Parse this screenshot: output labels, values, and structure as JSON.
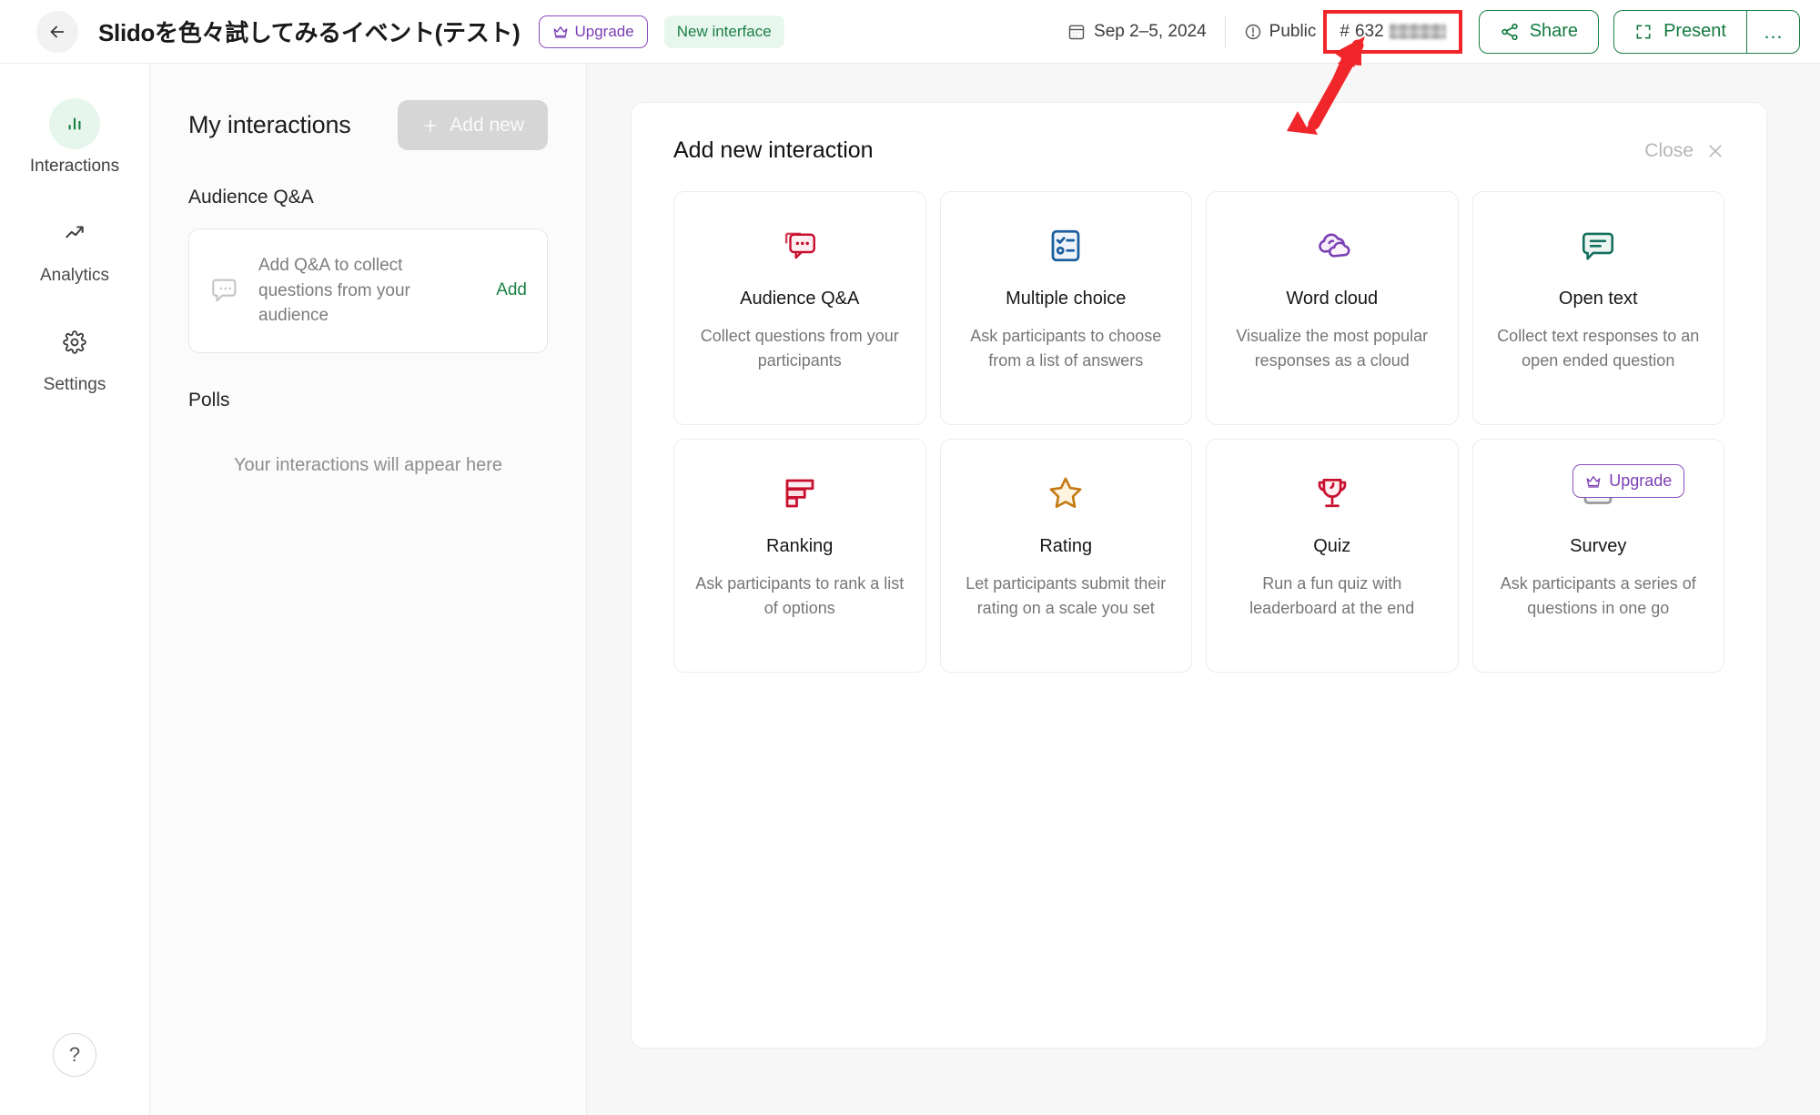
{
  "header": {
    "back_icon": "arrow-left-icon",
    "title": "Slidoを色々試してみるイベント(テスト)",
    "upgrade_label": "Upgrade",
    "upgrade_icon": "crown-icon",
    "new_interface_label": "New interface",
    "date_label": "Sep 2–5, 2024",
    "date_icon": "calendar-icon",
    "visibility_label": "Public",
    "visibility_icon": "info-circle-icon",
    "event_code_prefix": "#",
    "event_code_value": "632",
    "event_code_redacted": true,
    "share_label": "Share",
    "share_icon": "share-icon",
    "present_label": "Present",
    "present_icon": "fullscreen-icon",
    "more_label": "…",
    "more_icon": "ellipsis-icon",
    "accent_green": "#1a7f45",
    "accent_purple": "#7b3fb3",
    "annotation_color": "#f0262b"
  },
  "sidebar": {
    "items": [
      {
        "label": "Interactions",
        "icon": "bar-chart-icon",
        "active": true
      },
      {
        "label": "Analytics",
        "icon": "trend-up-icon",
        "active": false
      },
      {
        "label": "Settings",
        "icon": "gear-icon",
        "active": false
      }
    ],
    "help_label": "?",
    "help_icon": "question-mark-icon"
  },
  "left_panel": {
    "title": "My interactions",
    "add_new_label": "Add new",
    "add_new_icon": "plus-icon",
    "section_qa_label": "Audience Q&A",
    "qa_card": {
      "icon": "chat-bubble-icon",
      "text": "Add Q&A to collect questions from your audience",
      "action_label": "Add"
    },
    "section_polls_label": "Polls",
    "empty_text": "Your interactions will appear here"
  },
  "main": {
    "panel_title": "Add new interaction",
    "close_label": "Close",
    "close_icon": "close-icon",
    "cards": [
      {
        "title": "Audience Q&A",
        "desc": "Collect questions from your participants",
        "icon": "chat-bubble-dots-icon",
        "color": "#c8102e",
        "badge": null
      },
      {
        "title": "Multiple choice",
        "desc": "Ask participants to choose from a list of answers",
        "icon": "checklist-icon",
        "color": "#1c5f9e",
        "badge": null
      },
      {
        "title": "Word cloud",
        "desc": "Visualize the most popular responses as a cloud",
        "icon": "cloud-icon",
        "color": "#7b3fb3",
        "badge": null
      },
      {
        "title": "Open text",
        "desc": "Collect text responses to an open ended question",
        "icon": "speech-lines-icon",
        "color": "#16705f",
        "badge": null
      },
      {
        "title": "Ranking",
        "desc": "Ask participants to rank a list of options",
        "icon": "ranking-bars-icon",
        "color": "#c8102e",
        "badge": null
      },
      {
        "title": "Rating",
        "desc": "Let participants submit their rating on a scale you set",
        "icon": "star-icon",
        "color": "#c47b16",
        "badge": null
      },
      {
        "title": "Quiz",
        "desc": "Run a fun quiz with leaderboard at the end",
        "icon": "trophy-icon",
        "color": "#c8102e",
        "badge": null
      },
      {
        "title": "Survey",
        "desc": "Ask participants a series of questions in one go",
        "icon": "survey-icon",
        "color": "#8d8d8d",
        "badge": "Upgrade"
      }
    ]
  }
}
